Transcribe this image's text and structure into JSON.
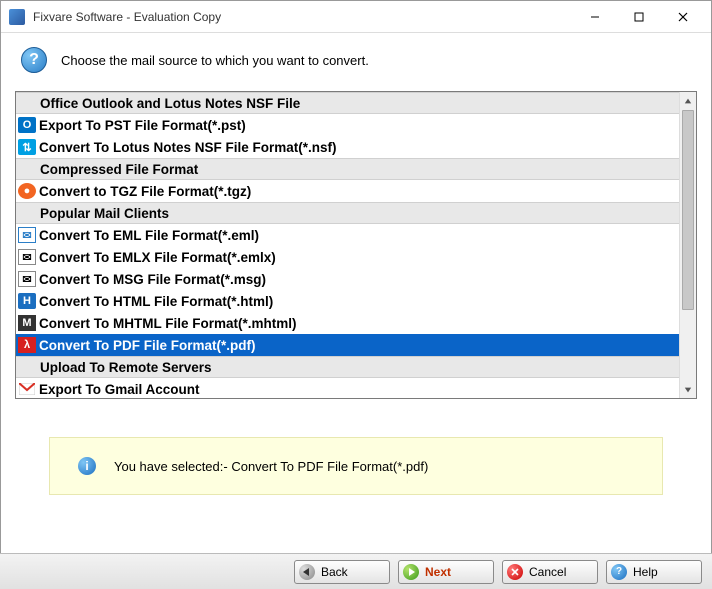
{
  "window": {
    "title": "Fixvare Software - Evaluation Copy"
  },
  "header": {
    "instruction": "Choose the mail source to which you want to convert."
  },
  "list": {
    "groups": [
      {
        "header": "Office Outlook and Lotus Notes NSF File",
        "items": [
          {
            "id": "pst",
            "label": "Export To PST File Format(*.pst)",
            "icon": "outlook"
          },
          {
            "id": "nsf",
            "label": "Convert To Lotus Notes NSF File Format(*.nsf)",
            "icon": "nsf"
          }
        ]
      },
      {
        "header": "Compressed File Format",
        "items": [
          {
            "id": "tgz",
            "label": "Convert to TGZ File Format(*.tgz)",
            "icon": "tgz"
          }
        ]
      },
      {
        "header": "Popular Mail Clients",
        "items": [
          {
            "id": "eml",
            "label": "Convert To EML File Format(*.eml)",
            "icon": "eml"
          },
          {
            "id": "emlx",
            "label": "Convert To EMLX File Format(*.emlx)",
            "icon": "emlx"
          },
          {
            "id": "msg",
            "label": "Convert To MSG File Format(*.msg)",
            "icon": "msg"
          },
          {
            "id": "html",
            "label": "Convert To HTML File Format(*.html)",
            "icon": "html"
          },
          {
            "id": "mhtml",
            "label": "Convert To MHTML File Format(*.mhtml)",
            "icon": "mhtml"
          },
          {
            "id": "pdf",
            "label": "Convert To PDF File Format(*.pdf)",
            "icon": "pdf",
            "selected": true
          }
        ]
      },
      {
        "header": "Upload To Remote Servers",
        "items": [
          {
            "id": "gmail",
            "label": "Export To Gmail Account",
            "icon": "gmail"
          }
        ]
      }
    ]
  },
  "status": {
    "text": "You have selected:- Convert To PDF File Format(*.pdf)"
  },
  "footer": {
    "back": "Back",
    "next": "Next",
    "cancel": "Cancel",
    "help": "Help"
  }
}
